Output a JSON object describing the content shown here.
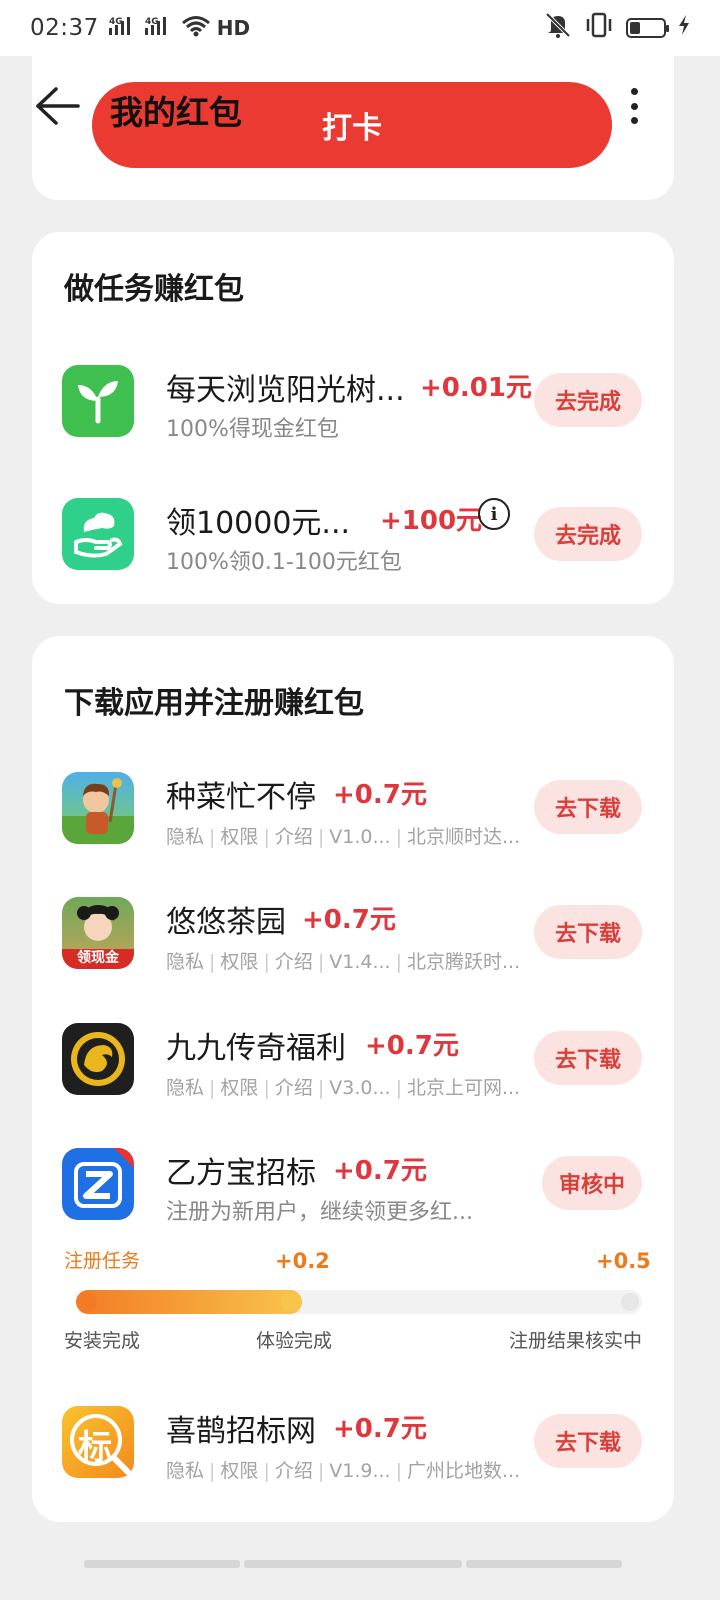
{
  "status_bar": {
    "time": "02:37",
    "signal_1": "4G",
    "signal_2": "4G",
    "hd": "HD",
    "icons": [
      "signal-icon",
      "signal-icon",
      "wifi-icon",
      "mute-icon",
      "vibrate-icon",
      "battery-icon",
      "charging-icon"
    ]
  },
  "header": {
    "title": "我的红包",
    "checkin_label": "打卡",
    "back_icon": "back-arrow-icon",
    "more_icon": "more-vertical-icon",
    "accent_color": "#ea3a32"
  },
  "tasks_section": {
    "title": "做任务赚红包",
    "items": [
      {
        "title": "每天浏览阳光树...",
        "reward": "+0.01元",
        "subtitle": "100%得现金红包",
        "button": "去完成",
        "icon": "sprout-icon",
        "icon_color": "#3fbf4f"
      },
      {
        "title": "领10000元...",
        "reward": "+100元",
        "subtitle": "100%领0.1-100元红包",
        "button": "去完成",
        "icon": "hand-cloud-icon",
        "icon_color": "#2fd08a",
        "info_icon": "i"
      }
    ]
  },
  "apps_section": {
    "title": "下载应用并注册赚红包",
    "items": [
      {
        "title": "种菜忙不停",
        "reward": "+0.7元",
        "meta": [
          "隐私",
          "权限",
          "介绍",
          "V1.0...",
          "北京顺时达..."
        ],
        "button": "去下载",
        "icon": "farm-game-icon"
      },
      {
        "title": "悠悠茶园",
        "reward": "+0.7元",
        "meta": [
          "隐私",
          "权限",
          "介绍",
          "V1.4...",
          "北京腾跃时..."
        ],
        "button": "去下载",
        "icon": "tea-garden-icon",
        "icon_badge": "领现金"
      },
      {
        "title": "九九传奇福利",
        "reward": "+0.7元",
        "meta": [
          "隐私",
          "权限",
          "介绍",
          "V3.0...",
          "北京上可网..."
        ],
        "button": "去下载",
        "icon": "dragon-coin-icon"
      },
      {
        "title": "乙方宝招标",
        "reward": "+0.7元",
        "subtitle": "注册为新用户，继续领更多红...",
        "button": "审核中",
        "icon": "z-logo-icon"
      },
      {
        "title": "喜鹊招标网",
        "reward": "+0.7元",
        "meta": [
          "隐私",
          "权限",
          "介绍",
          "V1.9...",
          "广州比地数..."
        ],
        "button": "去下载",
        "icon": "bid-logo-icon",
        "icon_text": "标"
      }
    ],
    "progress": {
      "task_label": "注册任务",
      "mid_reward": "+0.2",
      "end_reward": "+0.5",
      "steps": [
        "安装完成",
        "体验完成",
        "注册结果核实中"
      ],
      "completed_fraction": 0.4
    }
  }
}
